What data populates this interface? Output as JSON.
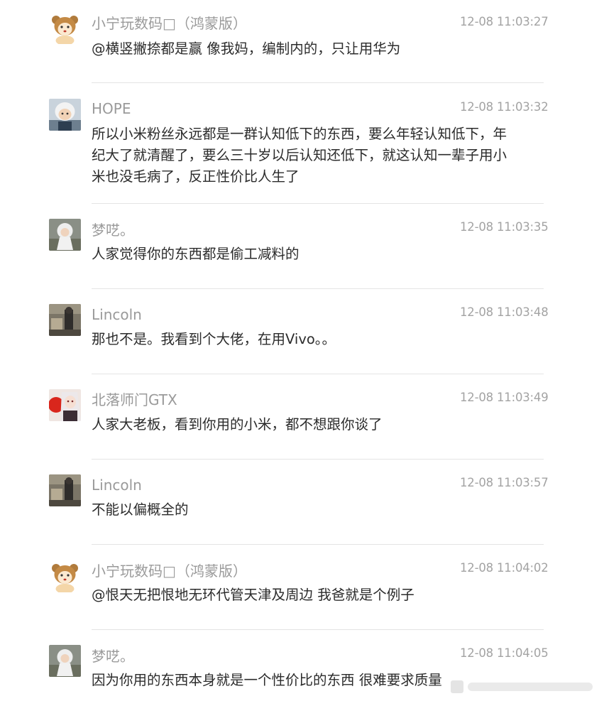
{
  "comments": [
    {
      "username": "小宁玩数码□（鸿蒙版）",
      "time": "12-08 11:03:27",
      "text": "@横竖撇捺都是赢 像我妈，编制内的，只让用华为",
      "avatar_icon": "bear-avatar-icon"
    },
    {
      "username": "HOPE",
      "time": "12-08 11:03:32",
      "text": "所以小米粉丝永远都是一群认知低下的东西，要么年轻认知低下，年纪大了就清醒了，要么三十岁以后认知还低下，就这认知一辈子用小米也没毛病了，反正性价比人生了",
      "avatar_icon": "astronaut-avatar-icon"
    },
    {
      "username": "梦呓。",
      "time": "12-08 11:03:35",
      "text": "人家觉得你的东西都是偷工减料的",
      "avatar_icon": "white-haired-figure-avatar-icon"
    },
    {
      "username": "Lincoln",
      "time": "12-08 11:03:48",
      "text": "那也不是。我看到个大佬，在用Vivo。。",
      "avatar_icon": "photo-avatar-icon"
    },
    {
      "username": "北落师门GTX",
      "time": "12-08 11:03:49",
      "text": "人家大老板，看到你用的小米，都不想跟你谈了",
      "avatar_icon": "anime-girl-avatar-icon"
    },
    {
      "username": "Lincoln",
      "time": "12-08 11:03:57",
      "text": "不能以偏概全的",
      "avatar_icon": "photo-avatar-icon"
    },
    {
      "username": "小宁玩数码□（鸿蒙版）",
      "time": "12-08 11:04:02",
      "text": "@恨天无把恨地无环代管天津及周边 我爸就是个例子",
      "avatar_icon": "bear-avatar-icon"
    },
    {
      "username": "梦呓。",
      "time": "12-08 11:04:05",
      "text": "因为你用的东西本身就是一个性价比的东西   很难要求质量",
      "avatar_icon": "white-haired-figure-avatar-icon"
    }
  ],
  "colors": {
    "username": "#9a9a9a",
    "timestamp": "#a3a3a3",
    "text": "#2b2b2b",
    "divider": "#e4e4e4"
  }
}
